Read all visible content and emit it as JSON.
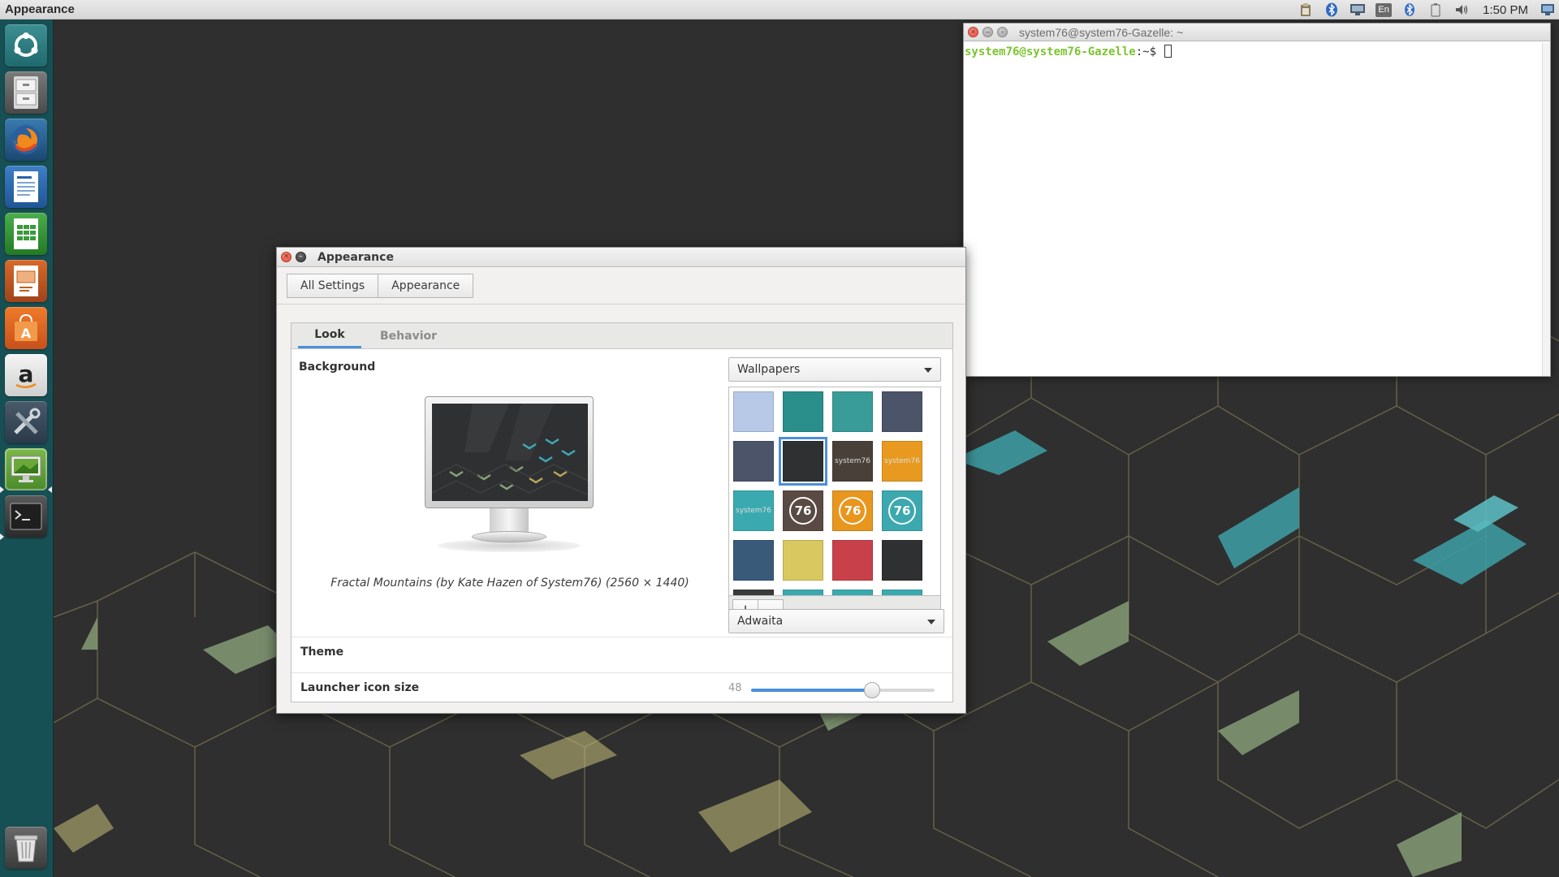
{
  "top_panel": {
    "app_title": "Appearance",
    "keyboard_layout": "En",
    "clock": "1:50 PM"
  },
  "launcher": {
    "items": [
      {
        "name": "dash-home",
        "icon": "ubuntu-logo-icon"
      },
      {
        "name": "files",
        "icon": "file-cabinet-icon"
      },
      {
        "name": "firefox",
        "icon": "firefox-icon"
      },
      {
        "name": "libreoffice-writer",
        "icon": "writer-doc-icon"
      },
      {
        "name": "libreoffice-calc",
        "icon": "calc-sheet-icon"
      },
      {
        "name": "libreoffice-impress",
        "icon": "impress-slides-icon"
      },
      {
        "name": "ubuntu-software",
        "icon": "software-bag-icon"
      },
      {
        "name": "amazon",
        "icon": "amazon-icon"
      },
      {
        "name": "system-settings",
        "icon": "tools-icon"
      },
      {
        "name": "appearance",
        "icon": "appearance-display-icon"
      },
      {
        "name": "terminal",
        "icon": "terminal-icon"
      },
      {
        "name": "trash",
        "icon": "trash-icon"
      }
    ]
  },
  "terminal": {
    "title": "system76@system76-Gazelle: ~",
    "prompt_user": "system76@system76-Gazelle",
    "prompt_path": ":~$ "
  },
  "appearance_window": {
    "title": "Appearance",
    "breadcrumb": {
      "all_settings": "All Settings",
      "current": "Appearance"
    },
    "tabs": {
      "look": "Look",
      "behavior": "Behavior"
    },
    "background_label": "Background",
    "wallpaper_caption": "Fractal Mountains (by Kate Hazen of System76) (2560 × 1440)",
    "wallpaper_source": "Wallpapers",
    "wallpaper_thumbs": [
      {
        "color": "#b8c9e8",
        "label": ""
      },
      {
        "color": "#2a8f8a",
        "label": ""
      },
      {
        "color": "#3a9c98",
        "label": ""
      },
      {
        "color": "#4b5468",
        "label": ""
      },
      {
        "color": "#4b5468",
        "label": ""
      },
      {
        "color": "#2f3032",
        "label": ""
      },
      {
        "color": "#4a403a",
        "label": "system76"
      },
      {
        "color": "#e89a20",
        "label": "system76"
      },
      {
        "color": "#3aaab0",
        "label": "system76"
      },
      {
        "color": "#5a4a44",
        "label": "76"
      },
      {
        "color": "#e8961e",
        "label": "76"
      },
      {
        "color": "#3ca8b0",
        "label": "76"
      },
      {
        "color": "#3a5a7a",
        "label": ""
      },
      {
        "color": "#d9c860",
        "label": ""
      },
      {
        "color": "#c8414a",
        "label": ""
      },
      {
        "color": "#2f3032",
        "label": ""
      }
    ],
    "add_button": "+",
    "remove_button": "−",
    "theme_label": "Theme",
    "theme_value": "Adwaita",
    "launcher_icon_size_label": "Launcher icon size",
    "launcher_icon_size": 48,
    "launcher_icon_size_fraction": 0.66
  },
  "colors": {
    "accent": "#4a90d9",
    "launcher_bg": "#165458",
    "desktop_bg": "#2f2f2f",
    "terminal_prompt": "#7cc430"
  }
}
